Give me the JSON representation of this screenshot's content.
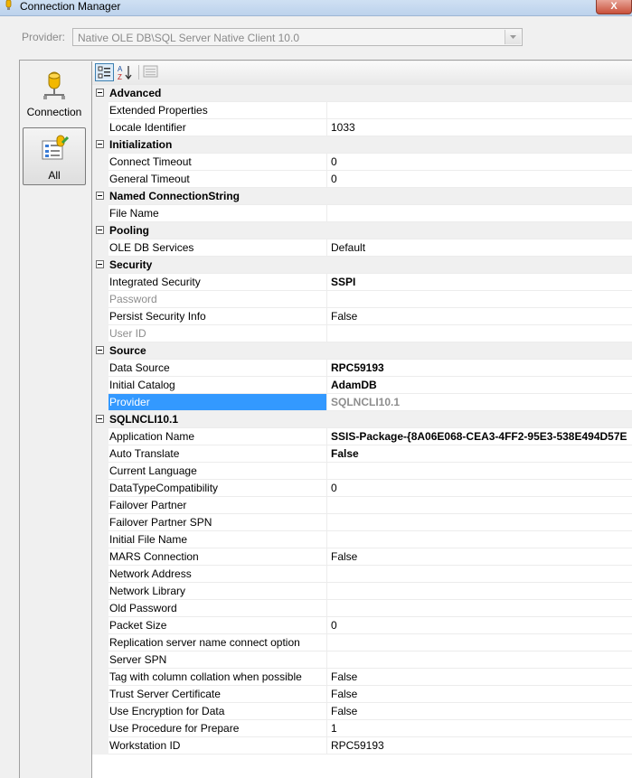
{
  "window": {
    "title": "Connection Manager",
    "close_label": "X"
  },
  "provider": {
    "label": "Provider:",
    "value": "Native OLE DB\\SQL Server Native Client 10.0"
  },
  "nav": [
    {
      "label": "Connection",
      "icon": "database-icon"
    },
    {
      "label": "All",
      "icon": "all-properties-icon",
      "selected": true
    }
  ],
  "toolbar": {
    "categorized": "categorized-icon",
    "alphabetical": "alphabetical-sort-icon",
    "pages": "property-pages-icon"
  },
  "categories": [
    {
      "name": "Advanced",
      "rows": [
        {
          "name": "Extended Properties",
          "value": ""
        },
        {
          "name": "Locale Identifier",
          "value": "1033"
        }
      ]
    },
    {
      "name": "Initialization",
      "rows": [
        {
          "name": "Connect Timeout",
          "value": "0"
        },
        {
          "name": "General Timeout",
          "value": "0"
        }
      ]
    },
    {
      "name": "Named ConnectionString",
      "rows": [
        {
          "name": "File Name",
          "value": ""
        }
      ]
    },
    {
      "name": "Pooling",
      "rows": [
        {
          "name": "OLE DB Services",
          "value": "Default"
        }
      ]
    },
    {
      "name": "Security",
      "rows": [
        {
          "name": "Integrated Security",
          "value": "SSPI",
          "bold": true
        },
        {
          "name": "Password",
          "value": "",
          "disabled": true
        },
        {
          "name": "Persist Security Info",
          "value": "False"
        },
        {
          "name": "User ID",
          "value": "",
          "disabled": true
        }
      ]
    },
    {
      "name": "Source",
      "rows": [
        {
          "name": "Data Source",
          "value": "RPC59193",
          "bold": true
        },
        {
          "name": "Initial Catalog",
          "value": "AdamDB",
          "bold": true
        },
        {
          "name": "Provider",
          "value": "SQLNCLI10.1",
          "selected": true
        }
      ]
    },
    {
      "name": "SQLNCLI10.1",
      "rows": [
        {
          "name": "Application Name",
          "value": "SSIS-Package-{8A06E068-CEA3-4FF2-95E3-538E494D57E",
          "bold": true
        },
        {
          "name": "Auto Translate",
          "value": "False",
          "bold": true
        },
        {
          "name": "Current Language",
          "value": ""
        },
        {
          "name": "DataTypeCompatibility",
          "value": "0"
        },
        {
          "name": "Failover Partner",
          "value": ""
        },
        {
          "name": "Failover Partner SPN",
          "value": ""
        },
        {
          "name": "Initial File Name",
          "value": ""
        },
        {
          "name": "MARS Connection",
          "value": "False"
        },
        {
          "name": "Network Address",
          "value": ""
        },
        {
          "name": "Network Library",
          "value": ""
        },
        {
          "name": "Old Password",
          "value": ""
        },
        {
          "name": "Packet Size",
          "value": "0"
        },
        {
          "name": "Replication server name connect option",
          "value": ""
        },
        {
          "name": "Server SPN",
          "value": ""
        },
        {
          "name": "Tag with column collation when possible",
          "value": "False"
        },
        {
          "name": "Trust Server Certificate",
          "value": "False"
        },
        {
          "name": "Use Encryption for Data",
          "value": "False"
        },
        {
          "name": "Use Procedure for Prepare",
          "value": "1"
        },
        {
          "name": "Workstation ID",
          "value": "RPC59193"
        }
      ]
    }
  ]
}
